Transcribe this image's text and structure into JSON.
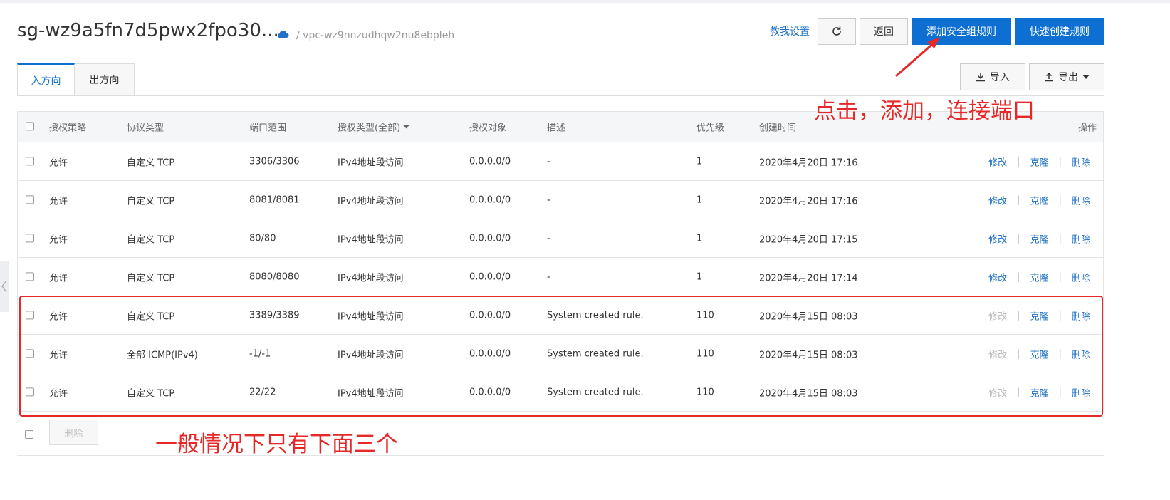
{
  "header": {
    "title": "sg-wz9a5fn7d5pwx2fpo30...",
    "vpc": "/ vpc-wz9nnzudhqw2nu8ebpleh",
    "help_link": "教我设置",
    "back": "返回",
    "add_rule": "添加安全组规则",
    "quick_create": "快速创建规则"
  },
  "tabs": [
    "入方向",
    "出方向"
  ],
  "toolbar": {
    "import": "导入",
    "export": "导出"
  },
  "table": {
    "columns": {
      "policy": "授权策略",
      "protocol": "协议类型",
      "port": "端口范围",
      "auth_type": "授权类型(全部)",
      "target": "授权对象",
      "desc": "描述",
      "priority": "优先级",
      "created": "创建时间",
      "ops": "操作"
    },
    "rows": [
      {
        "policy": "允许",
        "protocol": "自定义 TCP",
        "port": "3306/3306",
        "auth_type": "IPv4地址段访问",
        "target": "0.0.0.0/0",
        "desc": "-",
        "priority": "1",
        "created": "2020年4月20日 17:16",
        "modify": "修改",
        "clone": "克隆",
        "delete": "删除"
      },
      {
        "policy": "允许",
        "protocol": "自定义 TCP",
        "port": "8081/8081",
        "auth_type": "IPv4地址段访问",
        "target": "0.0.0.0/0",
        "desc": "-",
        "priority": "1",
        "created": "2020年4月20日 17:16",
        "modify": "修改",
        "clone": "克隆",
        "delete": "删除"
      },
      {
        "policy": "允许",
        "protocol": "自定义 TCP",
        "port": "80/80",
        "auth_type": "IPv4地址段访问",
        "target": "0.0.0.0/0",
        "desc": "-",
        "priority": "1",
        "created": "2020年4月20日 17:15",
        "modify": "修改",
        "clone": "克隆",
        "delete": "删除"
      },
      {
        "policy": "允许",
        "protocol": "自定义 TCP",
        "port": "8080/8080",
        "auth_type": "IPv4地址段访问",
        "target": "0.0.0.0/0",
        "desc": "-",
        "priority": "1",
        "created": "2020年4月20日 17:14",
        "modify": "修改",
        "clone": "克隆",
        "delete": "删除"
      },
      {
        "policy": "允许",
        "protocol": "自定义 TCP",
        "port": "3389/3389",
        "auth_type": "IPv4地址段访问",
        "target": "0.0.0.0/0",
        "desc": "System created rule.",
        "priority": "110",
        "created": "2020年4月15日 08:03",
        "modify": "修改",
        "clone": "克隆",
        "delete": "删除"
      },
      {
        "policy": "允许",
        "protocol": "全部 ICMP(IPv4)",
        "port": "-1/-1",
        "auth_type": "IPv4地址段访问",
        "target": "0.0.0.0/0",
        "desc": "System created rule.",
        "priority": "110",
        "created": "2020年4月15日 08:03",
        "modify": "修改",
        "clone": "克隆",
        "delete": "删除"
      },
      {
        "policy": "允许",
        "protocol": "自定义 TCP",
        "port": "22/22",
        "auth_type": "IPv4地址段访问",
        "target": "0.0.0.0/0",
        "desc": "System created rule.",
        "priority": "110",
        "created": "2020年4月15日 08:03",
        "modify": "修改",
        "clone": "克隆",
        "delete": "删除"
      }
    ]
  },
  "footer": {
    "delete": "删除"
  },
  "annotations": {
    "click_note": "点击，添加，连接端口",
    "bottom_note": "一般情况下只有下面三个"
  }
}
